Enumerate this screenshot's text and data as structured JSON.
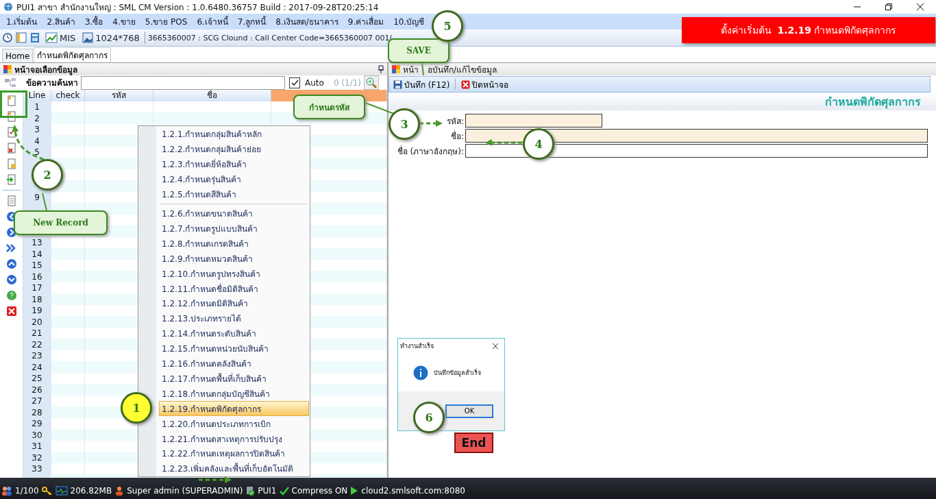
{
  "window": {
    "title": "PUI1 สาขา สำนักงานใหญ่ : SML CM Version : 1.0.6480.36757  Build : 2017-09-28T20:25:14"
  },
  "menu": [
    "1.เริ่มต้น",
    "2.สินค้า",
    "3.ซื้อ",
    "4.ขาย",
    "5.ขาย POS",
    "6.เจ้าหนี้",
    "7.ลูกหนี้",
    "8.เงินสด/ธนาคาร",
    "9.ค่าเสื่อม",
    "10.บัญชี"
  ],
  "toolbar": {
    "mis": "MIS",
    "resolution": "1024*768",
    "info": "3665360007 : SCG Clound : Call Center Code=3665360007 001("
  },
  "banner": "ตั้งค่าเริ่มต้น  **1.2.19** กำหนดพิกัดศุลกากร",
  "tabs": [
    {
      "label": "Home",
      "selected": false
    },
    {
      "label": "กำหนดพิกัดศุลกากร",
      "selected": true
    }
  ],
  "left_panel": {
    "title": "หน้าจอเลือกข้อมูล",
    "search_label": "ข้อความค้นหา",
    "auto": {
      "label": "Auto",
      "checked": true
    },
    "count": "0 (1/1)",
    "columns": [
      "Line",
      "check",
      "รหัส",
      "ชื่อ"
    ],
    "rows": [
      "1",
      "2",
      "3",
      "4",
      "5",
      null,
      null,
      null,
      "9",
      null,
      null,
      null,
      "13",
      "14",
      "15",
      "16",
      "17",
      "18",
      "19",
      "20",
      "21",
      "22",
      "23",
      "24",
      "25",
      "26",
      "27",
      "28",
      "29",
      "30",
      "31",
      "32",
      "33"
    ]
  },
  "context_menu": [
    {
      "kind": "item",
      "label": "1.2.1.กำหนดกลุ่มสินค้าหลัก",
      "selected": false
    },
    {
      "kind": "item",
      "label": "1.2.2.กำหนดกลุ่มสินค้าย่อย",
      "selected": false
    },
    {
      "kind": "item",
      "label": "1.2.3.กำหนดยี่ห้อสินค้า",
      "selected": false
    },
    {
      "kind": "item",
      "label": "1.2.4.กำหนดรุ่นสินค้า",
      "selected": false
    },
    {
      "kind": "item",
      "label": "1.2.5.กำหนดสีสินค้า",
      "selected": false
    },
    {
      "kind": "separator"
    },
    {
      "kind": "item",
      "label": "1.2.6.กำหนดขนาดสินค้า",
      "selected": false
    },
    {
      "kind": "item",
      "label": "1.2.7.กำหนดรูปแบบสินค้า",
      "selected": false
    },
    {
      "kind": "item",
      "label": "1.2.8.กำหนดเกรดสินค้า",
      "selected": false
    },
    {
      "kind": "item",
      "label": "1.2.9.กำหนดหมวดสินค้า",
      "selected": false
    },
    {
      "kind": "item",
      "label": "1.2.10.กำหนดรูปทรงสินค้า",
      "selected": false
    },
    {
      "kind": "item",
      "label": "1.2.11.กำหนดชื่อมิติสินค้า",
      "selected": false
    },
    {
      "kind": "item",
      "label": "1.2.12.กำหนดมิติสินค้า",
      "selected": false
    },
    {
      "kind": "item",
      "label": "1.2.13.ประเภทรายได้",
      "selected": false
    },
    {
      "kind": "item",
      "label": "1.2.14.กำหนดระดับสินค้า",
      "selected": false
    },
    {
      "kind": "item",
      "label": "1.2.15.กำหนดหน่วยนับสินค้า",
      "selected": false
    },
    {
      "kind": "item",
      "label": "1.2.16.กำหนดคลังสินค้า",
      "selected": false
    },
    {
      "kind": "item",
      "label": "1.2.17.กำหนดพื้นที่เก็บสินค้า",
      "selected": false
    },
    {
      "kind": "item",
      "label": "1.2.18.กำหนดกลุ่มบัญชีสินค้า",
      "selected": false
    },
    {
      "kind": "item",
      "label": "1.2.19.กำหนดพิกัดศุลกากร",
      "selected": true
    },
    {
      "kind": "item",
      "label": "1.2.20.กำหนดประเภทการเบิก",
      "selected": false
    },
    {
      "kind": "item",
      "label": "1.2.21.กำหนดสาเหตุการปรับปรุง",
      "selected": false
    },
    {
      "kind": "item",
      "label": "1.2.22.กำหนดเหตุผลการปิดสินค้า",
      "selected": false
    },
    {
      "kind": "item",
      "label": "1.2.23.เพิ่มคลังและพื้นที่เก็บอัตโนมัติ",
      "selected": false
    }
  ],
  "right_panel": {
    "title_parts": [
      "หน้า",
      "อบันทึก/แก้ไขข้อมูล"
    ],
    "save": "บันทึก (F12)",
    "close": "ปิดหน้าจอ",
    "form_title": "กำหนดพิกัดศุลกากร",
    "fields": [
      {
        "label": "รหัส:",
        "kind": "short",
        "required": true
      },
      {
        "label": "ชื่อ:",
        "kind": "long",
        "required": true
      },
      {
        "label": "ชื่อ (ภาษาอังกฤษ):",
        "kind": "long",
        "required": false
      }
    ]
  },
  "dialog": {
    "title": "ทำงานสำเร็จ",
    "message": "บันทึกข้อมูลสำเร็จ",
    "button": "OK"
  },
  "end_button": "End",
  "status_bar": {
    "users": "1/100",
    "memory": "206.82MB",
    "user": "Super admin (SUPERADMIN)",
    "database": "PUI1",
    "compress": "Compress ON",
    "server": "cloud2.smlsoft.com:8080"
  },
  "annotations": {
    "steps": [
      {
        "number": "1",
        "color": "#ffff33"
      },
      {
        "number": "2",
        "color": "#ffffff"
      },
      {
        "number": "3",
        "color": "#ffffff"
      },
      {
        "number": "4",
        "color": "#ffffff"
      },
      {
        "number": "5",
        "color": "#ffffff"
      },
      {
        "number": "6",
        "color": "#ffffff"
      }
    ],
    "callouts": [
      "SAVE",
      "New Record",
      "กำหนดรหัส"
    ]
  }
}
